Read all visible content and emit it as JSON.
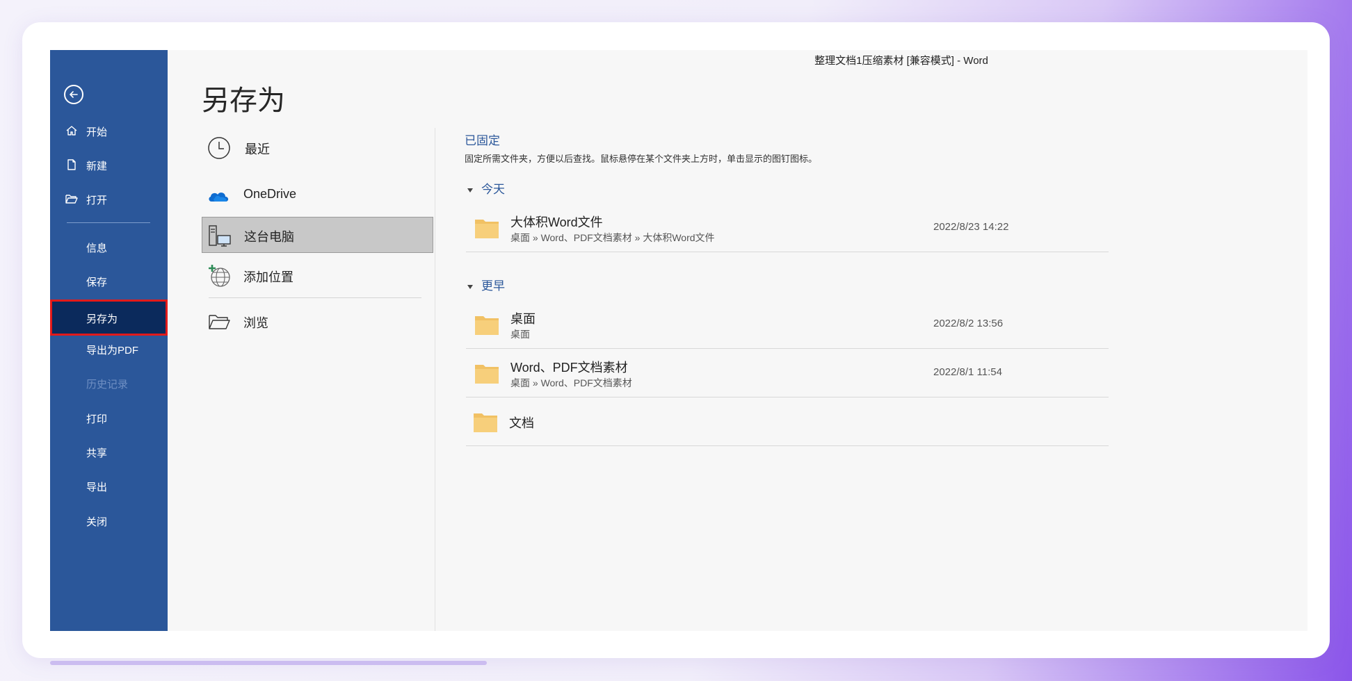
{
  "window": {
    "title": "整理文档1压缩素材 [兼容模式]  -  Word"
  },
  "sidebar": {
    "back_icon": "arrow-left-circle-icon",
    "items": [
      {
        "label": "开始",
        "icon": "home-icon"
      },
      {
        "label": "新建",
        "icon": "new-document-icon"
      },
      {
        "label": "打开",
        "icon": "open-folder-icon"
      },
      {
        "label": "信息"
      },
      {
        "label": "保存"
      },
      {
        "label": "另存为",
        "active": true
      },
      {
        "label": "导出为PDF"
      },
      {
        "label": "历史记录",
        "disabled": true
      },
      {
        "label": "打印"
      },
      {
        "label": "共享"
      },
      {
        "label": "导出"
      },
      {
        "label": "关闭"
      }
    ]
  },
  "main": {
    "title": "另存为",
    "locations": [
      {
        "label": "最近",
        "icon": "clock-icon"
      },
      {
        "label": "OneDrive",
        "icon": "cloud-icon"
      },
      {
        "label": "这台电脑",
        "icon": "computer-icon",
        "selected": true
      },
      {
        "label": "添加位置",
        "icon": "globe-add-icon"
      },
      {
        "label": "浏览",
        "icon": "folder-open-icon"
      }
    ]
  },
  "files": {
    "pinned_title": "已固定",
    "pinned_desc": "固定所需文件夹，方便以后查找。鼠标悬停在某个文件夹上方时，单击显示的图钉图标。",
    "today_label": "今天",
    "earlier_label": "更早",
    "today": [
      {
        "name": "大体积Word文件",
        "path": "桌面 » Word、PDF文档素材 » 大体积Word文件",
        "date": "2022/8/23 14:22"
      }
    ],
    "earlier": [
      {
        "name": "桌面",
        "path": "桌面",
        "date": "2022/8/2 13:56"
      },
      {
        "name": "Word、PDF文档素材",
        "path": "桌面 » Word、PDF文档素材",
        "date": "2022/8/1 11:54"
      },
      {
        "name": "文档"
      }
    ]
  },
  "colors": {
    "sidebar": "#2b579a",
    "active_item": "#0b2a5c",
    "highlight_border": "#e21a1a",
    "accent_text": "#2b579a",
    "folder": "#f7cf7b"
  }
}
